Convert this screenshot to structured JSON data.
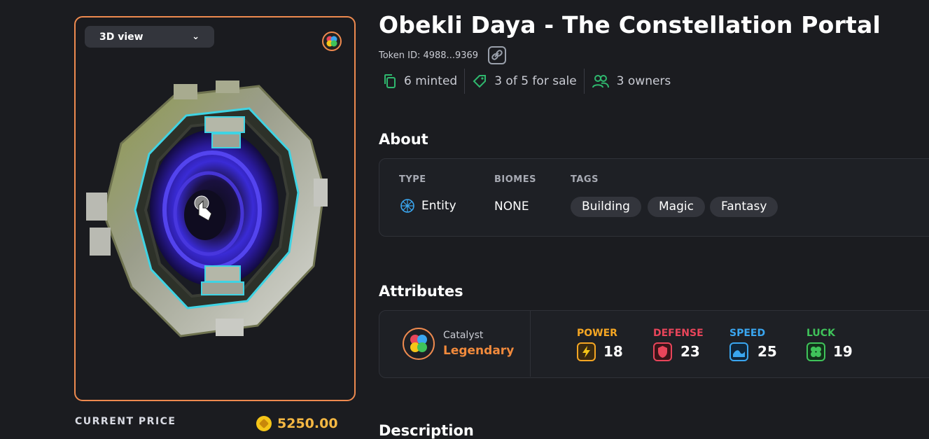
{
  "viewer": {
    "view_label": "3D view"
  },
  "price": {
    "label": "CURRENT PRICE",
    "value": "5250.00"
  },
  "asset": {
    "title": "Obekli Daya - The Constellation Portal",
    "token_id": "Token ID: 4988...9369",
    "minted": "6 minted",
    "for_sale": "3 of 5 for sale",
    "owners": "3 owners"
  },
  "about": {
    "heading": "About",
    "type_label": "TYPE",
    "type_value": "Entity",
    "biomes_label": "BIOMES",
    "biomes_value": "NONE",
    "tags_label": "TAGS",
    "tags": [
      "Building",
      "Magic",
      "Fantasy"
    ]
  },
  "attributes": {
    "heading": "Attributes",
    "catalyst_label": "Catalyst",
    "catalyst_value": "Legendary",
    "stats": [
      {
        "name": "POWER",
        "value": "18",
        "color": "#f5a623",
        "icon": "lightning-icon"
      },
      {
        "name": "DEFENSE",
        "value": "23",
        "color": "#e8455a",
        "icon": "shield-icon"
      },
      {
        "name": "SPEED",
        "value": "25",
        "color": "#3aa6f0",
        "icon": "wave-icon"
      },
      {
        "name": "LUCK",
        "value": "19",
        "color": "#3fc35a",
        "icon": "clover-icon"
      }
    ]
  },
  "description": {
    "heading": "Description"
  },
  "colors": {
    "accent": "#ee8a4f",
    "legendary": "#f28a3c",
    "gold": "#f5b843",
    "green_icon": "#2fb86e"
  }
}
